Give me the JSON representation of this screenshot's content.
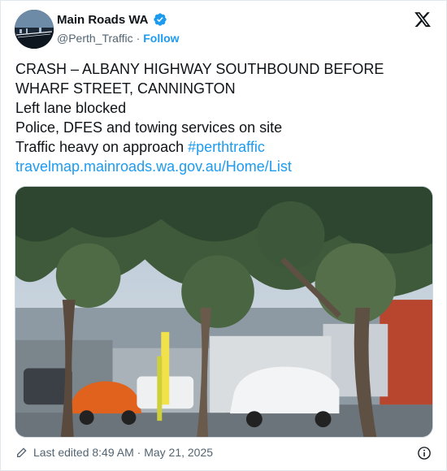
{
  "author": {
    "display_name": "Main Roads WA",
    "handle": "@Perth_Traffic",
    "separator": "·",
    "follow_label": "Follow",
    "verified_icon": "verified-badge-icon",
    "verified_color": "#1d9bf0"
  },
  "tweet": {
    "lines": [
      "CRASH – ALBANY HIGHWAY SOUTHBOUND BEFORE",
      "WHARF STREET, CANNINGTON",
      "Left lane blocked",
      "Police, DFES and towing services on site"
    ],
    "last_line_text": "Traffic heavy on approach ",
    "hashtag": "#perthtraffic",
    "link": "travelmap.mainroads.wa.gov.au/Home/List"
  },
  "footer": {
    "edited_text": "Last edited 8:49 AM · May 21, 2025"
  },
  "colors": {
    "accent": "#1d9bf0",
    "muted": "#536471",
    "text": "#0f1419"
  }
}
